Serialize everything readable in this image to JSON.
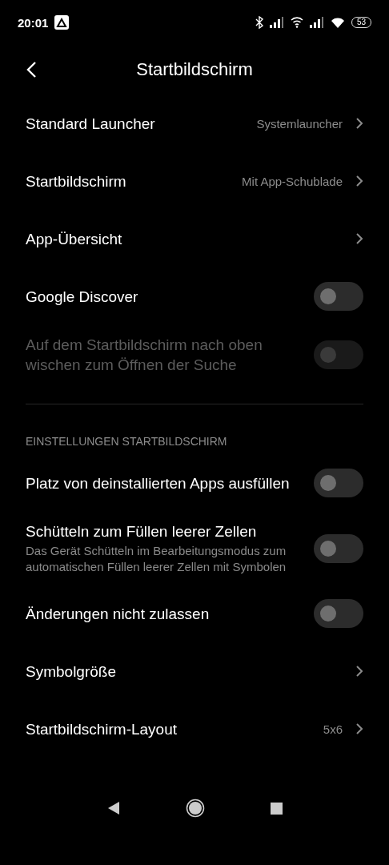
{
  "status_bar": {
    "time": "20:01",
    "battery": "53"
  },
  "header": {
    "title": "Startbildschirm"
  },
  "items": [
    {
      "kind": "nav",
      "label": "Standard Launcher",
      "value": "Systemlauncher"
    },
    {
      "kind": "nav",
      "label": "Startbildschirm",
      "value": "Mit App-Schublade"
    },
    {
      "kind": "nav",
      "label": "App-Übersicht"
    },
    {
      "kind": "toggle",
      "label": "Google Discover",
      "on": false,
      "disabled": false
    },
    {
      "kind": "toggle",
      "label": "Auf dem Startbildschirm nach oben wischen zum Öffnen der Suche",
      "on": false,
      "disabled": true
    }
  ],
  "section": {
    "title": "EINSTELLUNGEN STARTBILDSCHIRM",
    "items": [
      {
        "kind": "toggle",
        "label": "Platz von deinstallierten Apps ausfüllen",
        "on": false,
        "disabled": false
      },
      {
        "kind": "toggle",
        "label": "Schütteln zum Füllen leerer Zellen",
        "subtitle": "Das Gerät Schütteln im Bearbeitungsmodus zum automatischen Füllen leerer Zellen mit Symbolen",
        "on": false,
        "disabled": false
      },
      {
        "kind": "toggle",
        "label": "Änderungen nicht zulassen",
        "on": false,
        "disabled": false
      },
      {
        "kind": "nav",
        "label": "Symbolgröße"
      },
      {
        "kind": "nav",
        "label": "Startbildschirm-Layout",
        "value": "5x6"
      }
    ]
  }
}
